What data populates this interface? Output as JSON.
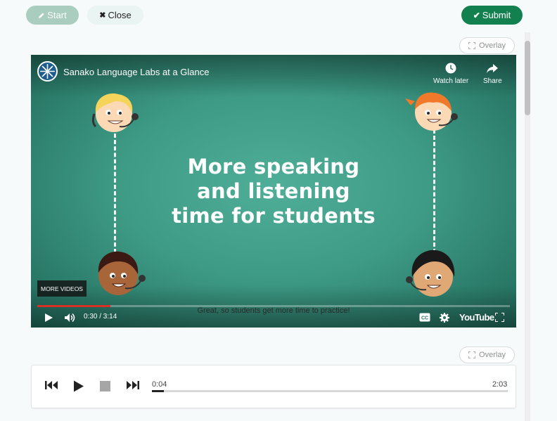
{
  "toolbar": {
    "start_label": "Start",
    "close_label": "Close",
    "submit_label": "Submit"
  },
  "overlay_label": "Overlay",
  "video": {
    "title": "Sanako Language Labs at a Glance",
    "watch_later_label": "Watch later",
    "share_label": "Share",
    "headline_lines": [
      "More speaking",
      "and listening",
      "time for students"
    ],
    "more_videos_label": "MORE VIDEOS",
    "subtitle": "Great, so students get more time to practice!",
    "time": "0:30 / 3:14",
    "progress": 0.155,
    "youtube_label": "YouTube"
  },
  "audio": {
    "current_time": "0:04",
    "duration": "2:03",
    "progress": 0.033
  },
  "colors": {
    "accent": "#13814f",
    "start_disabled": "#a9cdbf",
    "video_bg": "#3e9b86",
    "progress": "#d93025"
  }
}
